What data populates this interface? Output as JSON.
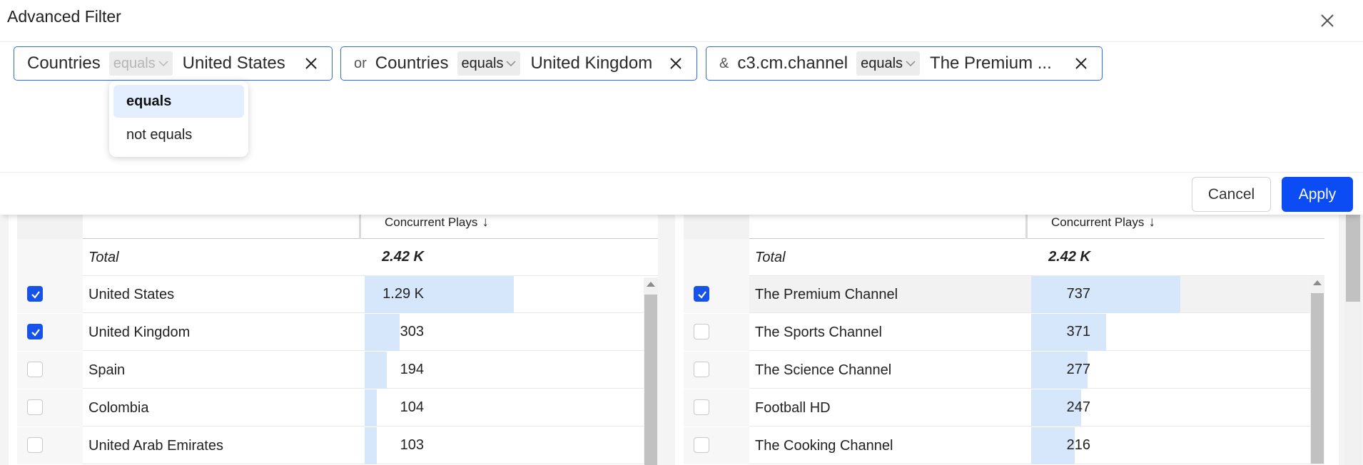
{
  "modal": {
    "title": "Advanced Filter",
    "close_icon": "close-icon"
  },
  "filters": [
    {
      "conjunction": "",
      "field": "Countries",
      "operator": "equals",
      "value": "United States"
    },
    {
      "conjunction": "or",
      "field": "Countries",
      "operator": "equals",
      "value": "United Kingdom"
    },
    {
      "conjunction": "&",
      "field": "c3.cm.channel",
      "operator": "equals",
      "value": "The Premium ..."
    }
  ],
  "operator_dropdown": {
    "options": [
      "equals",
      "not equals"
    ],
    "selected": "equals"
  },
  "footer": {
    "cancel_label": "Cancel",
    "apply_label": "Apply"
  },
  "left_table": {
    "header": "Concurrent Plays",
    "sort_icon": "arrow-down-icon",
    "total_label": "Total",
    "total_value": "2.42 K",
    "rows": [
      {
        "name": "United States",
        "value": "1.29 K",
        "checked": true,
        "bar_fraction": 1.0
      },
      {
        "name": "United Kingdom",
        "value": "303",
        "checked": true,
        "bar_fraction": 0.235
      },
      {
        "name": "Spain",
        "value": "194",
        "checked": false,
        "bar_fraction": 0.15
      },
      {
        "name": "Colombia",
        "value": "104",
        "checked": false,
        "bar_fraction": 0.081
      },
      {
        "name": "United Arab Emirates",
        "value": "103",
        "checked": false,
        "bar_fraction": 0.08
      }
    ]
  },
  "right_table": {
    "header": "Concurrent Plays",
    "sort_icon": "arrow-down-icon",
    "total_label": "Total",
    "total_value": "2.42 K",
    "rows": [
      {
        "name": "The Premium Channel",
        "value": "737",
        "checked": true,
        "bar_fraction": 1.0
      },
      {
        "name": "The Sports Channel",
        "value": "371",
        "checked": false,
        "bar_fraction": 0.503
      },
      {
        "name": "The Science Channel",
        "value": "277",
        "checked": false,
        "bar_fraction": 0.376
      },
      {
        "name": "Football HD",
        "value": "247",
        "checked": false,
        "bar_fraction": 0.335
      },
      {
        "name": "The Cooking Channel",
        "value": "216",
        "checked": false,
        "bar_fraction": 0.293
      }
    ]
  },
  "colors": {
    "accent": "#0b4cf4",
    "chip_border": "#2b6cf6",
    "bar": "#d6e6fb",
    "checkbox_checked": "#1753e8"
  }
}
